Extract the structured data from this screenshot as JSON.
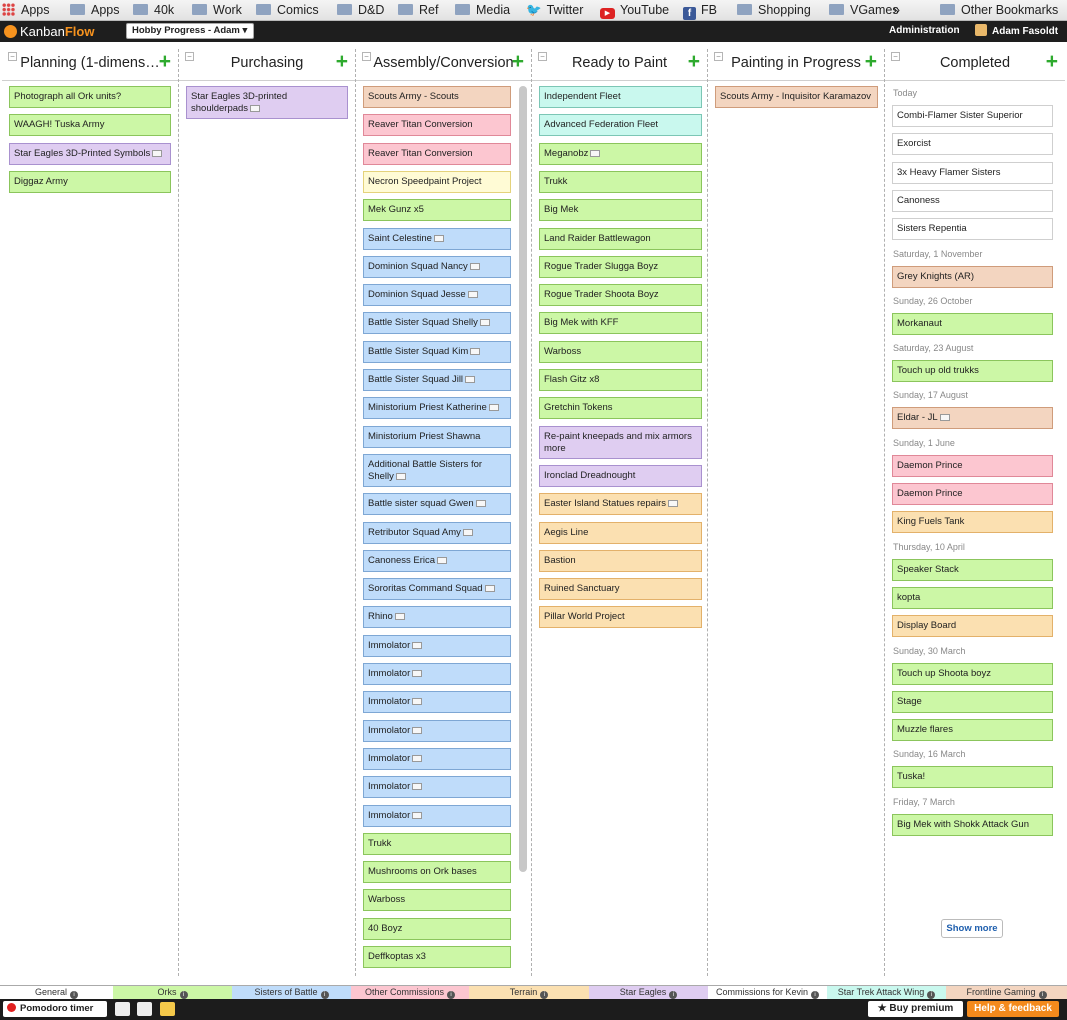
{
  "bookmarks": {
    "apps_label": "Apps",
    "items": [
      "Apps",
      "40k",
      "Work",
      "Comics",
      "D&D",
      "Ref",
      "Media",
      "Twitter",
      "YouTube",
      "FB",
      "Shopping",
      "VGames"
    ],
    "more": "»",
    "other": "Other Bookmarks"
  },
  "topbar": {
    "logo_a": "Kanban",
    "logo_b": "Flow",
    "board": "Hobby Progress - Adam",
    "board_caret": "▾",
    "admin": "Administration",
    "user": "Adam Fasoldt"
  },
  "colors": {
    "green": "#ccf7a6",
    "blue": "#bfdcfa",
    "pink": "#fcc6d0",
    "purple": "#dfcdf1",
    "orange": "#fbe0b1",
    "teal": "#c9f8ee",
    "tan": "#f3d5c0",
    "yellow": "#fffbd5",
    "accent": "#f7931e",
    "add": "#2eaa2e"
  },
  "columns": [
    {
      "title": "Planning (1-dimens…",
      "tasks": [
        {
          "t": "Photograph all Ork units?",
          "c": "g"
        },
        {
          "t": "WAAGH! Tuska Army",
          "c": "g"
        },
        {
          "t": "Star Eagles 3D-Printed Symbols",
          "c": "pu",
          "n": true
        },
        {
          "t": "Diggaz Army",
          "c": "g"
        }
      ]
    },
    {
      "title": "Purchasing",
      "tasks": [
        {
          "t": "Star Eagles 3D-printed shoulderpads",
          "c": "pu",
          "n": true,
          "h2": true
        }
      ]
    },
    {
      "title": "Assembly/Conversion",
      "tasks": [
        {
          "t": "Scouts Army - Scouts",
          "c": "tan"
        },
        {
          "t": "Reaver Titan Conversion",
          "c": "pk"
        },
        {
          "t": "Reaver Titan Conversion",
          "c": "pk"
        },
        {
          "t": "Necron Speedpaint Project",
          "c": "y"
        },
        {
          "t": "Mek Gunz x5",
          "c": "g"
        },
        {
          "t": "Saint Celestine",
          "c": "b",
          "n": true
        },
        {
          "t": "Dominion Squad Nancy",
          "c": "b",
          "n": true
        },
        {
          "t": "Dominion Squad Jesse",
          "c": "b",
          "n": true
        },
        {
          "t": "Battle Sister Squad Shelly",
          "c": "b",
          "n": true
        },
        {
          "t": "Battle Sister Squad Kim",
          "c": "b",
          "n": true
        },
        {
          "t": "Battle Sister Squad Jill",
          "c": "b",
          "n": true
        },
        {
          "t": "Ministorium Priest Katherine",
          "c": "b",
          "n": true
        },
        {
          "t": "Ministorium Priest Shawna",
          "c": "b"
        },
        {
          "t": "Additional Battle Sisters for Shelly",
          "c": "b",
          "n": true,
          "h2": true
        },
        {
          "t": "Battle sister squad Gwen",
          "c": "b",
          "n": true
        },
        {
          "t": "Retributor Squad Amy",
          "c": "b",
          "n": true
        },
        {
          "t": "Canoness Erica",
          "c": "b",
          "n": true
        },
        {
          "t": "Sororitas Command Squad",
          "c": "b",
          "n": true
        },
        {
          "t": "Rhino",
          "c": "b",
          "n": true
        },
        {
          "t": "Immolator",
          "c": "b",
          "n": true
        },
        {
          "t": "Immolator",
          "c": "b",
          "n": true
        },
        {
          "t": "Immolator",
          "c": "b",
          "n": true
        },
        {
          "t": "Immolator",
          "c": "b",
          "n": true
        },
        {
          "t": "Immolator",
          "c": "b",
          "n": true
        },
        {
          "t": "Immolator",
          "c": "b",
          "n": true
        },
        {
          "t": "Immolator",
          "c": "b",
          "n": true
        },
        {
          "t": "Trukk",
          "c": "g"
        },
        {
          "t": "Mushrooms on Ork bases",
          "c": "g"
        },
        {
          "t": "Warboss",
          "c": "g"
        },
        {
          "t": "40 Boyz",
          "c": "g"
        },
        {
          "t": "Deffkoptas x3",
          "c": "g"
        }
      ]
    },
    {
      "title": "Ready to Paint",
      "tasks": [
        {
          "t": "Independent Fleet",
          "c": "t"
        },
        {
          "t": "Advanced Federation Fleet",
          "c": "t"
        },
        {
          "t": "Meganobz",
          "c": "g",
          "n": true
        },
        {
          "t": "Trukk",
          "c": "g"
        },
        {
          "t": "Big Mek",
          "c": "g"
        },
        {
          "t": "Land Raider Battlewagon",
          "c": "g"
        },
        {
          "t": "Rogue Trader Slugga Boyz",
          "c": "g"
        },
        {
          "t": "Rogue Trader Shoota Boyz",
          "c": "g"
        },
        {
          "t": "Big Mek with KFF",
          "c": "g"
        },
        {
          "t": "Warboss",
          "c": "g"
        },
        {
          "t": "Flash Gitz x8",
          "c": "g"
        },
        {
          "t": "Gretchin Tokens",
          "c": "g"
        },
        {
          "t": "Re-paint kneepads and mix armors more",
          "c": "pu",
          "h2": true
        },
        {
          "t": "Ironclad Dreadnought",
          "c": "pu"
        },
        {
          "t": "Easter Island Statues repairs",
          "c": "o",
          "n": true
        },
        {
          "t": "Aegis Line",
          "c": "o"
        },
        {
          "t": "Bastion",
          "c": "o"
        },
        {
          "t": "Ruined Sanctuary",
          "c": "o"
        },
        {
          "t": "Pillar World Project",
          "c": "o"
        }
      ]
    },
    {
      "title": "Painting in Progress",
      "tasks": [
        {
          "t": "Scouts Army - Inquisitor Karamazov",
          "c": "tan"
        }
      ]
    },
    {
      "title": "Completed",
      "tasks": [
        {
          "d": "Today"
        },
        {
          "t": "Combi-Flamer Sister Superior",
          "c": "w"
        },
        {
          "t": "Exorcist",
          "c": "w"
        },
        {
          "t": "3x Heavy Flamer Sisters",
          "c": "w"
        },
        {
          "t": "Canoness",
          "c": "w"
        },
        {
          "t": "Sisters Repentia",
          "c": "w"
        },
        {
          "d": "Saturday, 1 November"
        },
        {
          "t": "Grey Knights (AR)",
          "c": "tan"
        },
        {
          "d": "Sunday, 26 October"
        },
        {
          "t": "Morkanaut",
          "c": "g"
        },
        {
          "d": "Saturday, 23 August"
        },
        {
          "t": "Touch up old trukks",
          "c": "g"
        },
        {
          "d": "Sunday, 17 August"
        },
        {
          "t": "Eldar - JL",
          "c": "tan",
          "n": true
        },
        {
          "d": "Sunday, 1 June"
        },
        {
          "t": "Daemon Prince",
          "c": "pk"
        },
        {
          "t": "Daemon Prince",
          "c": "pk"
        },
        {
          "t": "King Fuels Tank",
          "c": "o"
        },
        {
          "d": "Thursday, 10 April"
        },
        {
          "t": "Speaker Stack",
          "c": "g"
        },
        {
          "t": "kopta",
          "c": "g"
        },
        {
          "t": "Display Board",
          "c": "o"
        },
        {
          "d": "Sunday, 30 March"
        },
        {
          "t": "Touch up Shoota boyz",
          "c": "g"
        },
        {
          "t": "Stage",
          "c": "g"
        },
        {
          "t": "Muzzle flares",
          "c": "g"
        },
        {
          "d": "Sunday, 16 March"
        },
        {
          "t": "Tuska!",
          "c": "g"
        },
        {
          "d": "Friday, 7 March"
        },
        {
          "t": "Big Mek with Shokk Attack Gun",
          "c": "g"
        }
      ]
    }
  ],
  "show_more": "Show more",
  "swimlanes": [
    {
      "label": "General",
      "bg": "#ffffff"
    },
    {
      "label": "Orks",
      "bg": "#ccf7a6"
    },
    {
      "label": "Sisters of Battle",
      "bg": "#bfdcfa"
    },
    {
      "label": "Other Commissions",
      "bg": "#fcc6d0"
    },
    {
      "label": "Terrain",
      "bg": "#fbe0b1"
    },
    {
      "label": "Star Eagles",
      "bg": "#dfcdf1"
    },
    {
      "label": "Commissions for Kevin",
      "bg": "#ffffff"
    },
    {
      "label": "Star Trek Attack Wing",
      "bg": "#c9f8ee"
    },
    {
      "label": "Frontline Gaming",
      "bg": "#f3d5c0"
    }
  ],
  "footer": {
    "pomodoro": "Pomodoro timer",
    "premium": "★ Buy premium",
    "help": "Help & feedback"
  }
}
